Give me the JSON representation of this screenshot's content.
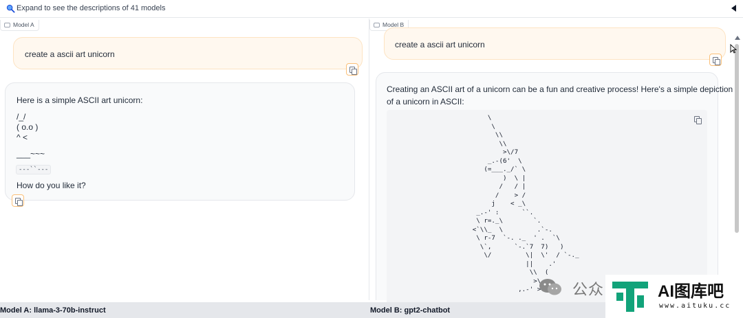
{
  "header": {
    "expand_label": "Expand to see the descriptions of 41 models"
  },
  "model_a": {
    "tag": "Model A",
    "prompt": "create a ascii art unicorn",
    "reply": {
      "intro": "Here is a simple ASCII art unicorn:",
      "art_lines": [
        "/_/",
        "( o.o )",
        "^ <",
        "___~~~"
      ],
      "code_inline": "---``---",
      "outro": "How do you like it?"
    }
  },
  "model_b": {
    "tag": "Model B",
    "prompt": "create a ascii art unicorn",
    "reply": {
      "intro_line1": "Creating an ASCII art of a unicorn can be a fun and creative process! Here's a simple depiction",
      "intro_line2": "of a unicorn in ASCII:",
      "code": "           \\\n            \\\n             \\\\\n              \\\\\n               >\\/7\n           _.-(6'  \\\n          (=___._/` \\\n               )  \\ |\n              /   / |\n             /    > /\n            j    < _\\\n        _.-' :      ``.\n        \\ r=._\\        `.\n       <`\\\\_  \\         .`-.\n        \\ r-7  `-. ._  ' .  `\\\n         \\`,      `-.`7  7)   )\n          \\/         \\|  \\'  / `-._\n                     ||    .'\n                      \\\\  (\n                       >\\  >\n                   ,.-' >.'"
    }
  },
  "footer": {
    "model_a_label": "Model A: llama-3-70b-instruct",
    "model_b_label": "Model B: gpt2-chatbot"
  },
  "watermark": {
    "cn_text": "公众",
    "brand": "AI图库吧",
    "url": "www.aituku.cc"
  },
  "colors": {
    "user_bubble": "#fff8ef",
    "bot_bubble": "#f9fafb",
    "accent_copy_border": "#fbbf77",
    "footer_bg": "#e5e7eb"
  }
}
